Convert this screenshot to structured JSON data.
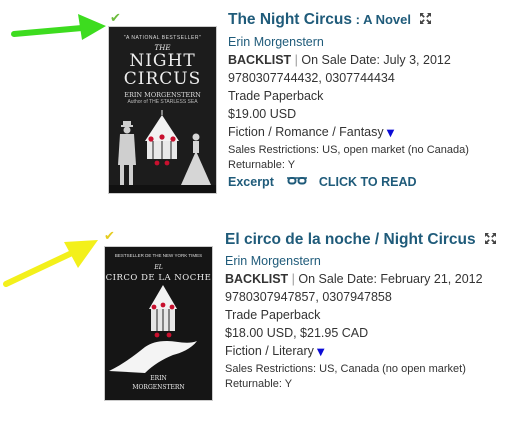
{
  "colors": {
    "arrow_green": "#3ddc1f",
    "arrow_yellow": "#f3f01b",
    "check_green": "#6cbb3c",
    "check_yellow": "#e5cc1f",
    "link": "#1f5b7a",
    "dropdown": "#0b0bd6"
  },
  "books": [
    {
      "title": "The Night Circus",
      "subtitle": " : A Novel",
      "author": "Erin Morgenstern",
      "status": "BACKLIST",
      "sep": " | ",
      "sale_date": "On Sale Date: July 3, 2012",
      "isbns": "9780307744432, 0307744434",
      "format": "Trade Paperback",
      "price": "$19.00 USD",
      "categories": "Fiction / Romance / Fantasy",
      "restrictions": "Sales Restrictions: US, open market (no Canada)",
      "returnable": "Returnable: Y",
      "excerpt_label": "Excerpt",
      "read_label": "CLICK TO READ",
      "cover": {
        "top_text": "\"A NATIONAL BESTSELLER\"",
        "title_line1": "THE",
        "title_line2": "NIGHT",
        "title_line3": "CIRCUS",
        "author_line": "ERIN MORGENSTERN",
        "sub_line": "Author of THE STARLESS SEA"
      }
    },
    {
      "title": "El circo de la noche / Night Circus",
      "subtitle": "",
      "author": "Erin Morgenstern",
      "status": "BACKLIST",
      "sep": " | ",
      "sale_date": "On Sale Date: February 21, 2012",
      "isbns": "9780307947857, 0307947858",
      "format": "Trade Paperback",
      "price": "$18.00 USD, $21.95 CAD",
      "categories": "Fiction / Literary",
      "restrictions": "Sales Restrictions: US, Canada (no open market)",
      "returnable": "Returnable: Y",
      "cover": {
        "top_text": "BESTSELLER DE THE NEW YORK TIMES",
        "title_line1": "EL",
        "title_line2": "CIRCO DE LA NOCHE",
        "author_line1": "ERIN",
        "author_line2": "MORGENSTERN"
      }
    }
  ]
}
